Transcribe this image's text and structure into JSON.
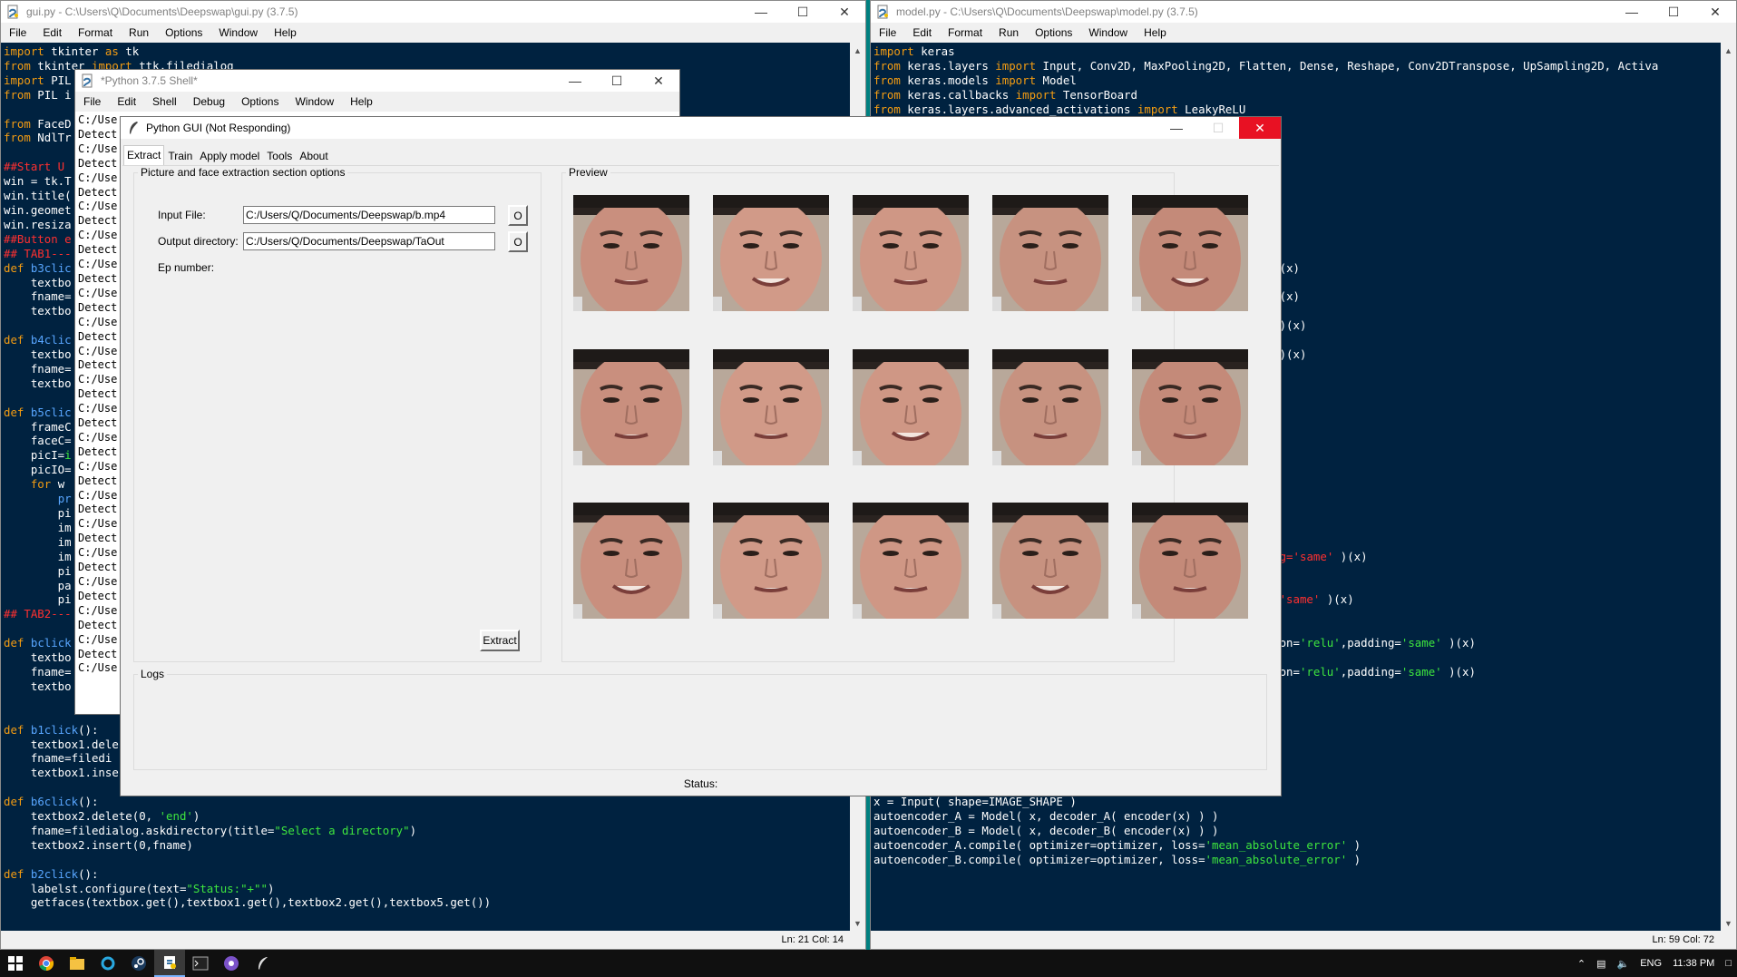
{
  "gui_editor": {
    "title": "gui.py - C:\\Users\\Q\\Documents\\Deepswap\\gui.py (3.7.5)",
    "menu": [
      "File",
      "Edit",
      "Format",
      "Run",
      "Options",
      "Window",
      "Help"
    ],
    "status": "Ln: 21   Col: 14"
  },
  "model_editor": {
    "title": "model.py - C:\\Users\\Q\\Documents\\Deepswap\\model.py (3.7.5)",
    "menu": [
      "File",
      "Edit",
      "Format",
      "Run",
      "Options",
      "Window",
      "Help"
    ],
    "status": "Ln: 59   Col: 72"
  },
  "shell": {
    "title": "*Python 3.7.5 Shell*",
    "menu": [
      "File",
      "Edit",
      "Shell",
      "Debug",
      "Options",
      "Window",
      "Help"
    ],
    "lines": [
      "C:/Use",
      "Detect",
      "C:/Use",
      "Detect",
      "C:/Use",
      "Detect",
      "C:/Use",
      "Detect",
      "C:/Use",
      "Detect",
      "C:/Use",
      "Detect",
      "C:/Use",
      "Detect",
      "C:/Use",
      "Detect",
      "C:/Use",
      "Detect",
      "C:/Use",
      "Detect",
      "C:/Use",
      "Detect",
      "C:/Use",
      "Detect",
      "C:/Use",
      "Detect",
      "C:/Use",
      "Detect",
      "C:/Use",
      "Detect",
      "C:/Use",
      "Detect",
      "C:/Use",
      "Detect",
      "C:/Use",
      "Detect",
      "C:/Use",
      "Detect",
      "C:/Use"
    ]
  },
  "python_gui": {
    "title": "Python GUI (Not Responding)",
    "tabs": [
      "Extract",
      "Train",
      "Apply model",
      "Tools",
      "About"
    ],
    "extract_section": "Picture and face extraction section options",
    "input_label": "Input File:",
    "input_value": "C:/Users/Q/Documents/Deepswap/b.mp4",
    "output_label": "Output directory:",
    "output_value": "C:/Users/Q/Documents/Deepswap/TaOut",
    "browse_label": "O",
    "ep_label": "Ep number:",
    "extract_btn": "Extract",
    "preview_label": "Preview",
    "logs_label": "Logs",
    "status": "Status:",
    "preview_count": 15
  },
  "taskbar": {
    "lang": "ENG",
    "time": "11:38 PM"
  }
}
